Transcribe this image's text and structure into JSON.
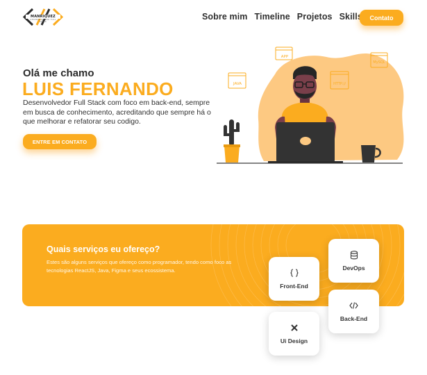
{
  "header": {
    "logo": {
      "name": "MANRIQUEZ",
      "tagline": "DESENVOLVEDOR FULL STACK"
    },
    "nav": [
      {
        "label": "Sobre mim"
      },
      {
        "label": "Timeline"
      },
      {
        "label": "Projetos"
      },
      {
        "label": "Skills"
      }
    ],
    "contact_label": "Contato"
  },
  "hero": {
    "greeting": "Olá me chamo",
    "name": "LUIS FERNANDO",
    "description": "Desenvolvedor Full Stack com foco em back-end, sempre em busca de conhecimento, acreditando que sempre há o que melhorar e refatorar seu codigo.",
    "cta_label": "ENTRE EM CONTATO",
    "illustration_tags": {
      "app": "APP",
      "mysql": "MySQL",
      "java": "JAVA",
      "http": "HTTP://"
    }
  },
  "services": {
    "title": "Quais serviços eu ofereço?",
    "description": "Estes são alguns serviços que ofereço como programador, tendo como foco as tecnologias ReactJS, Java, Figma e seus ecossistema.",
    "cards": [
      {
        "label": "Front-End",
        "icon": "code-braces-icon"
      },
      {
        "label": "DevOps",
        "icon": "database-icon"
      },
      {
        "label": "Back-End",
        "icon": "code-tag-icon"
      },
      {
        "label": "Ui Design",
        "icon": "design-tools-icon"
      }
    ]
  },
  "colors": {
    "accent": "#fbac1f",
    "accent_light": "#fdc982",
    "text": "#2b2b2b",
    "background": "#ffffff"
  }
}
